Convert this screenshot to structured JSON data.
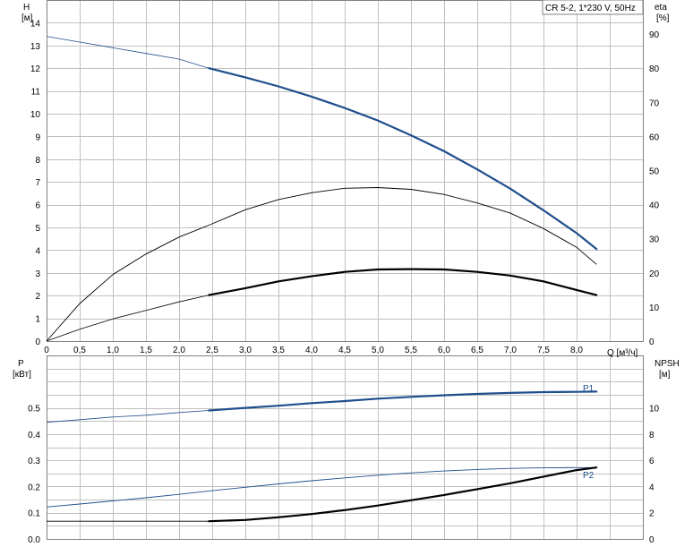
{
  "chart_data": [
    {
      "type": "line",
      "title": "CR 5-2, 1*230 V, 50Hz",
      "xlabel": "Q [м³/ч]",
      "ylabel_left": "H",
      "ylabel_left_unit": "[м]",
      "ylabel_right": "eta",
      "ylabel_right_unit": "[%]",
      "xlim": [
        0,
        9.0
      ],
      "ylim_left": [
        0,
        15
      ],
      "ylim_right": [
        0,
        100
      ],
      "x_ticks": [
        "0",
        "0,5",
        "1,0",
        "1,5",
        "2,0",
        "2,5",
        "3,0",
        "3,5",
        "4,0",
        "4,5",
        "5,0",
        "5,5",
        "6,0",
        "6,5",
        "7,0",
        "7,5",
        "8,0"
      ],
      "y_left_ticks": [
        "0",
        "1",
        "2",
        "3",
        "4",
        "5",
        "6",
        "7",
        "8",
        "9",
        "10",
        "11",
        "12",
        "13",
        "14"
      ],
      "y_right_ticks": [
        "0",
        "10",
        "20",
        "30",
        "40",
        "50",
        "60",
        "70",
        "80",
        "90"
      ],
      "grid": true,
      "series": [
        {
          "axis": "left",
          "color": "#1f4e8c",
          "x": [
            0,
            0.5,
            1.0,
            1.5,
            2.0,
            2.45,
            3.0,
            3.5,
            4.0,
            4.5,
            5.0,
            5.5,
            6.0,
            6.5,
            7.0,
            7.5,
            8.0,
            8.3
          ],
          "y": [
            13.4,
            13.15,
            12.9,
            12.65,
            12.4,
            12.0,
            11.6,
            11.2,
            10.75,
            10.25,
            9.7,
            9.05,
            8.35,
            7.55,
            6.7,
            5.75,
            4.75,
            4.05
          ]
        },
        {
          "axis": "right",
          "color": "#000000",
          "x": [
            0,
            0.5,
            1.0,
            1.5,
            2.0,
            2.45,
            3.0,
            3.5,
            4.0,
            4.5,
            5.0,
            5.5,
            6.0,
            6.5,
            7.0,
            7.5,
            8.0,
            8.3
          ],
          "y": [
            0,
            11,
            19.5,
            25.5,
            30.5,
            34,
            38.5,
            41.5,
            43.5,
            44.8,
            45,
            44.5,
            43,
            40.5,
            37.5,
            33,
            27.5,
            22.5
          ]
        },
        {
          "axis": "right",
          "color": "#000000",
          "x": [
            0,
            0.5,
            1.0,
            1.5,
            2.0,
            2.45,
            3.0,
            3.5,
            4.0,
            4.5,
            5.0,
            5.5,
            6.0,
            6.5,
            7.0,
            7.5,
            8.0,
            8.3
          ],
          "y": [
            0,
            3.5,
            6.5,
            9,
            11.5,
            13.5,
            15.5,
            17.5,
            19,
            20.3,
            21,
            21.1,
            21,
            20.3,
            19.2,
            17.5,
            15,
            13.5
          ]
        }
      ]
    },
    {
      "type": "line",
      "xlabel": "",
      "ylabel_left": "P",
      "ylabel_left_unit": "[кВт]",
      "ylabel_right": "NPSH",
      "ylabel_right_unit": "[м]",
      "xlim": [
        0,
        9.0
      ],
      "ylim_left": [
        0,
        0.7
      ],
      "ylim_right": [
        0,
        14
      ],
      "y_left_ticks": [
        "0.0",
        "0.1",
        "0.2",
        "0.3",
        "0.4",
        "0.5"
      ],
      "y_right_ticks": [
        "0",
        "2",
        "4",
        "6",
        "8",
        "10"
      ],
      "grid": true,
      "series": [
        {
          "name": "P1",
          "axis": "left",
          "color": "#1f4e8c",
          "x": [
            0,
            0.5,
            1.0,
            1.5,
            2.0,
            2.45,
            3.0,
            3.5,
            4.0,
            4.5,
            5.0,
            5.5,
            6.0,
            6.5,
            7.0,
            7.5,
            8.0,
            8.3
          ],
          "y": [
            0.445,
            0.455,
            0.465,
            0.472,
            0.482,
            0.49,
            0.5,
            0.508,
            0.518,
            0.526,
            0.535,
            0.542,
            0.548,
            0.553,
            0.557,
            0.56,
            0.561,
            0.562
          ]
        },
        {
          "name": "P2",
          "axis": "left",
          "color": "#1f4e8c",
          "x": [
            0,
            0.5,
            1.0,
            1.5,
            2.0,
            2.45,
            3.0,
            3.5,
            4.0,
            4.5,
            5.0,
            5.5,
            6.0,
            6.5,
            7.0,
            7.5,
            8.0,
            8.3
          ],
          "y": [
            0.122,
            0.133,
            0.145,
            0.157,
            0.17,
            0.183,
            0.197,
            0.21,
            0.222,
            0.233,
            0.243,
            0.252,
            0.259,
            0.265,
            0.269,
            0.271,
            0.272,
            0.272
          ]
        },
        {
          "axis": "right",
          "color": "#000000",
          "x": [
            0,
            0.5,
            1.0,
            1.5,
            2.0,
            2.45,
            3.0,
            3.5,
            4.0,
            4.5,
            5.0,
            5.5,
            6.0,
            6.5,
            7.0,
            7.5,
            8.0,
            8.3
          ],
          "y": [
            1.35,
            1.35,
            1.35,
            1.35,
            1.35,
            1.35,
            1.45,
            1.65,
            1.9,
            2.2,
            2.55,
            2.95,
            3.35,
            3.8,
            4.25,
            4.75,
            5.25,
            5.45
          ]
        }
      ],
      "curve_labels": [
        "P1",
        "P2"
      ]
    }
  ]
}
